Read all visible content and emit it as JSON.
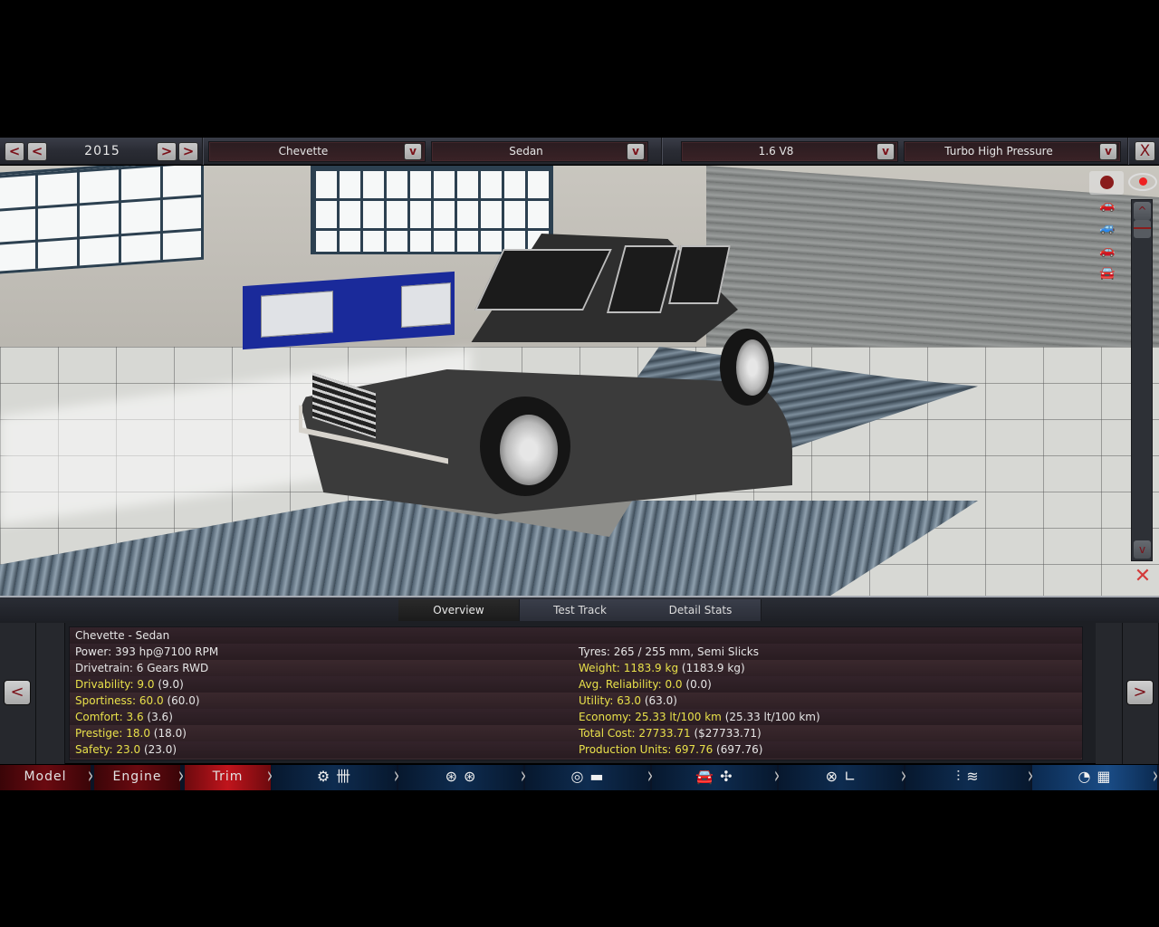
{
  "topbar": {
    "year": "2015",
    "prev_fast_label": "<",
    "prev_label": "<",
    "next_label": ">",
    "next_fast_label": ">",
    "model": "Chevette",
    "body": "Sedan",
    "engine": "1.6 V8",
    "fixture": "Turbo High Pressure",
    "dropdown_glyph": "v",
    "close_glyph": "X"
  },
  "viewport": {
    "camera_icons": [
      "camera-icon",
      "eye-icon"
    ],
    "view_icons": [
      "front-view",
      "side-view",
      "rear-view",
      "perspective-view"
    ],
    "scroll_up": "^",
    "scroll_down": "v",
    "hide_glyph": "✕"
  },
  "panel": {
    "tabs": [
      {
        "label": "Overview",
        "active": true
      },
      {
        "label": "Test Track",
        "active": false
      },
      {
        "label": "Detail Stats",
        "active": false
      }
    ],
    "prev_label": "<",
    "next_label": ">",
    "title": "Chevette - Sedan",
    "left_stats": [
      {
        "key": "Power:",
        "value": "393 hp@7100 RPM",
        "paren": "",
        "highlight": false
      },
      {
        "key": "Drivetrain:",
        "value": "6 Gears RWD",
        "paren": "",
        "highlight": false
      },
      {
        "key": "Drivability:",
        "value": "9.0",
        "paren": "(9.0)",
        "highlight": true
      },
      {
        "key": "Sportiness:",
        "value": "60.0",
        "paren": "(60.0)",
        "highlight": true
      },
      {
        "key": "Comfort:",
        "value": "3.6",
        "paren": "(3.6)",
        "highlight": true
      },
      {
        "key": "Prestige:",
        "value": "18.0",
        "paren": "(18.0)",
        "highlight": true
      },
      {
        "key": "Safety:",
        "value": "23.0",
        "paren": "(23.0)",
        "highlight": true
      }
    ],
    "right_stats": [
      {
        "key": "Tyres:",
        "value": "265 / 255 mm, Semi Slicks",
        "paren": "",
        "highlight": false
      },
      {
        "key": "Weight:",
        "value": "1183.9 kg",
        "paren": "(1183.9 kg)",
        "highlight": true
      },
      {
        "key": "Avg. Reliability:",
        "value": "0.0",
        "paren": "(0.0)",
        "highlight": true
      },
      {
        "key": "Utility:",
        "value": "63.0",
        "paren": "(63.0)",
        "highlight": true
      },
      {
        "key": "Economy:",
        "value": "25.33 lt/100 km",
        "paren": "(25.33 lt/100 km)",
        "highlight": true
      },
      {
        "key": "Total Cost:",
        "value": "27733.71",
        "paren": "($27733.71)",
        "highlight": true
      },
      {
        "key": "Production Units:",
        "value": "697.76",
        "paren": "(697.76)",
        "highlight": true
      }
    ]
  },
  "progress": {
    "steps": [
      {
        "label": "Model",
        "state": "done"
      },
      {
        "label": "Engine",
        "state": "done"
      },
      {
        "label": "Trim",
        "state": "active"
      }
    ],
    "icon_steps": [
      {
        "name": "gearbox",
        "glyphs": [
          "⚙",
          "卌"
        ]
      },
      {
        "name": "wheels",
        "glyphs": [
          "⊛",
          "⊛"
        ]
      },
      {
        "name": "brakes",
        "glyphs": [
          "◎",
          "▬"
        ]
      },
      {
        "name": "aero-cooling",
        "glyphs": [
          "🚘",
          "✣"
        ]
      },
      {
        "name": "interior",
        "glyphs": [
          "⊗",
          "∟"
        ]
      },
      {
        "name": "suspension",
        "glyphs": [
          "⫶",
          "≋"
        ]
      },
      {
        "name": "testing",
        "glyphs": [
          "◔",
          "▦"
        ]
      }
    ],
    "chevron": "›"
  },
  "colors": {
    "highlight_text": "#e8e04a",
    "accent_red": "#7a1018",
    "active_step": "#c0141c"
  }
}
